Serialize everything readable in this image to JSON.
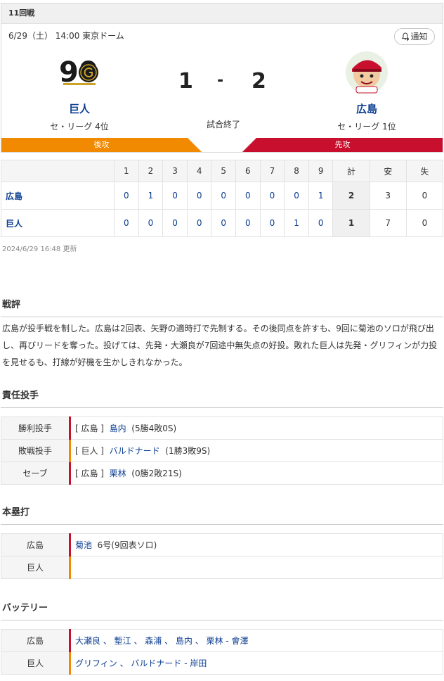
{
  "game": {
    "round": "11回戦",
    "date_place": "6/29（土） 14:00 東京ドーム",
    "notify_label": "通知",
    "home": {
      "name": "巨人",
      "rank": "セ・リーグ 4位",
      "logo_text": "90"
    },
    "away": {
      "name": "広島",
      "rank": "セ・リーグ 1位"
    },
    "home_score": "1",
    "dash": "-",
    "away_score": "2",
    "status": "試合終了",
    "home_side": "後攻",
    "away_side": "先攻"
  },
  "scoreboard": {
    "headers": [
      "1",
      "2",
      "3",
      "4",
      "5",
      "6",
      "7",
      "8",
      "9",
      "計",
      "安",
      "失"
    ],
    "rows": [
      {
        "team": "広島",
        "innings": [
          "0",
          "1",
          "0",
          "0",
          "0",
          "0",
          "0",
          "0",
          "1"
        ],
        "r": "2",
        "h": "3",
        "e": "0"
      },
      {
        "team": "巨人",
        "innings": [
          "0",
          "0",
          "0",
          "0",
          "0",
          "0",
          "0",
          "1",
          "0"
        ],
        "r": "1",
        "h": "7",
        "e": "0"
      }
    ],
    "updated": "2024/6/29 16:48 更新"
  },
  "review": {
    "title": "戦評",
    "text": "広島が投手戦を制した。広島は2回表、矢野の適時打で先制する。その後同点を許すも、9回に菊池のソロが飛び出し、再びリードを奪った。投げては、先発・大瀬良が7回途中無失点の好投。敗れた巨人は先発・グリフィンが力投を見せるも、打線が好機を生かしきれなかった。"
  },
  "pitchers": {
    "title": "責任投手",
    "rows": [
      {
        "label": "勝利投手",
        "team": "[ 広島 ]",
        "name": "島内",
        "stat": "(5勝4敗0S)",
        "side": "away"
      },
      {
        "label": "敗戦投手",
        "team": "[ 巨人 ]",
        "name": "バルドナード",
        "stat": "(1勝3敗9S)",
        "side": "home"
      },
      {
        "label": "セーブ",
        "team": "[ 広島 ]",
        "name": "栗林",
        "stat": "(0勝2敗21S)",
        "side": "away"
      }
    ]
  },
  "homeruns": {
    "title": "本塁打",
    "rows": [
      {
        "label": "広島",
        "name": "菊池",
        "stat": "6号(9回表ソロ)"
      },
      {
        "label": "巨人",
        "name": "",
        "stat": ""
      }
    ]
  },
  "battery": {
    "title": "バッテリー",
    "rows": [
      {
        "label": "広島",
        "pitchers": "大瀬良 、 塹江 、 森浦 、 島内 、 栗林",
        "catcher": " - 會澤"
      },
      {
        "label": "巨人",
        "pitchers": "グリフィン 、 バルドナード",
        "catcher": " - 岸田"
      }
    ]
  }
}
